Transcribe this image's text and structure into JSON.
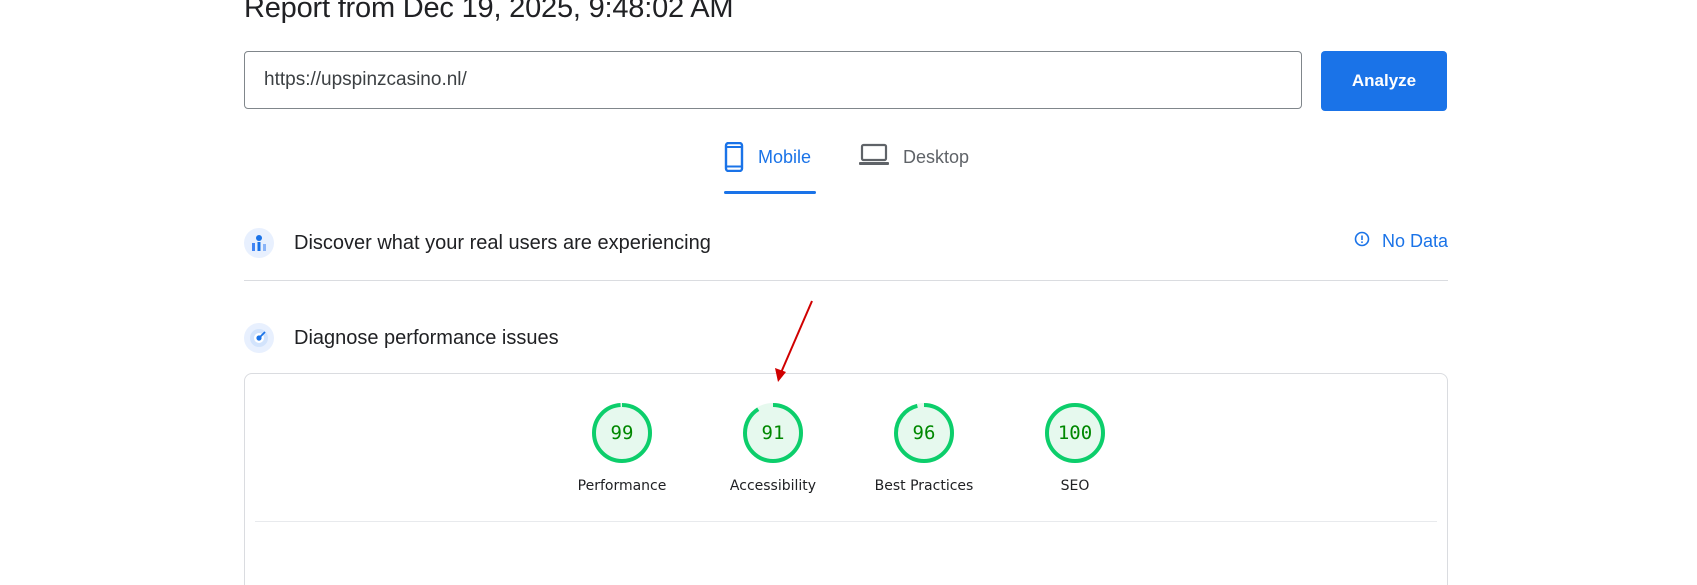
{
  "report": {
    "title": "Report from Dec 19, 2025, 9:48:02 AM"
  },
  "url_input": {
    "value": "https://upspinzcasino.nl/"
  },
  "analyze_button": {
    "label": "Analyze"
  },
  "tabs": [
    {
      "label": "Mobile",
      "icon": "smartphone-icon",
      "selected": true
    },
    {
      "label": "Desktop",
      "icon": "laptop-icon",
      "selected": false
    }
  ],
  "real_users": {
    "title": "Discover what your real users are experiencing",
    "icon": "users-chart-icon",
    "status": "No Data",
    "status_icon": "info-icon"
  },
  "diagnose": {
    "title": "Diagnose performance issues",
    "icon": "gauge-icon"
  },
  "scores": [
    {
      "label": "Performance",
      "value": "99",
      "fraction": 0.99
    },
    {
      "label": "Accessibility",
      "value": "91",
      "fraction": 0.91
    },
    {
      "label": "Best Practices",
      "value": "96",
      "fraction": 0.96
    },
    {
      "label": "SEO",
      "value": "100",
      "fraction": 1.0
    }
  ],
  "colors": {
    "accent": "#1a73e8",
    "score_good": "#0cce6b",
    "score_good_fill": "#e6f9ee",
    "score_text": "#008800",
    "annotation_arrow": "#d00000"
  }
}
